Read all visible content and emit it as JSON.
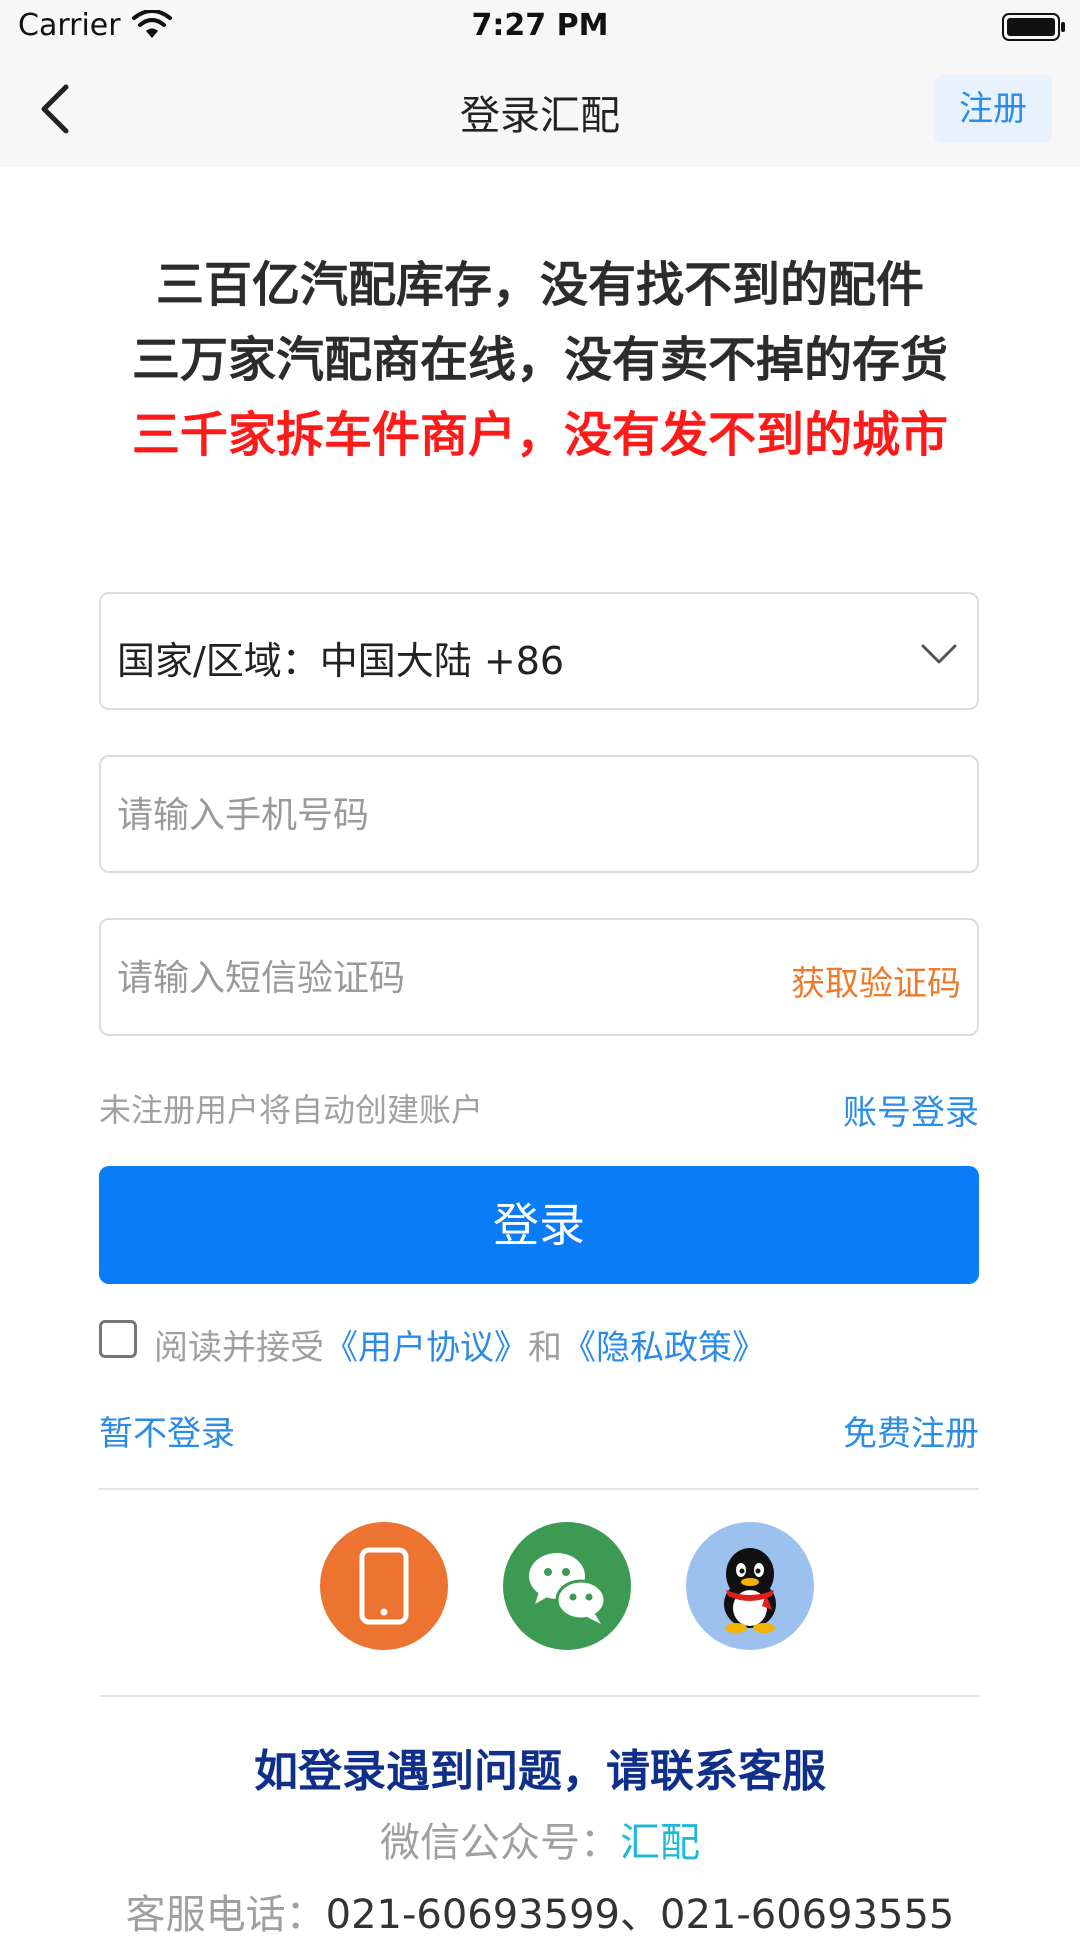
{
  "status_bar": {
    "carrier": "Carrier",
    "time": "7:27 PM"
  },
  "nav": {
    "title": "登录汇配",
    "register_label": "注册"
  },
  "slogans": [
    "三百亿汽配库存，没有找不到的配件",
    "三万家汽配商在线，没有卖不掉的存货",
    "三千家拆车件商户，没有发不到的城市"
  ],
  "form": {
    "country_label": "国家/区域：中国大陆 +86",
    "phone_placeholder": "请输入手机号码",
    "sms_placeholder": "请输入短信验证码",
    "get_code_label": "获取验证码",
    "hint": "未注册用户将自动创建账户",
    "account_login_label": "账号登录",
    "login_label": "登录"
  },
  "agreement": {
    "prefix": "阅读并接受",
    "user_agreement": "《用户协议》",
    "and": "和",
    "privacy_policy": "《隐私政策》"
  },
  "links": {
    "skip_login": "暂不登录",
    "free_register": "免费注册"
  },
  "social_icons": [
    "phone-icon",
    "wechat-icon",
    "qq-icon"
  ],
  "contact": {
    "title": "如登录遇到问题，请联系客服",
    "wechat_label": "微信公众号：",
    "wechat_name": "汇配",
    "phone_label": "客服电话：",
    "phone_numbers": "021-60693599、021-60693555"
  },
  "colors": {
    "primary": "#0a7cf6",
    "link": "#2b8ce8",
    "red_slogan": "#ff1a1a",
    "orange": "#f07a2a",
    "contact_title": "#0f2f8a"
  }
}
